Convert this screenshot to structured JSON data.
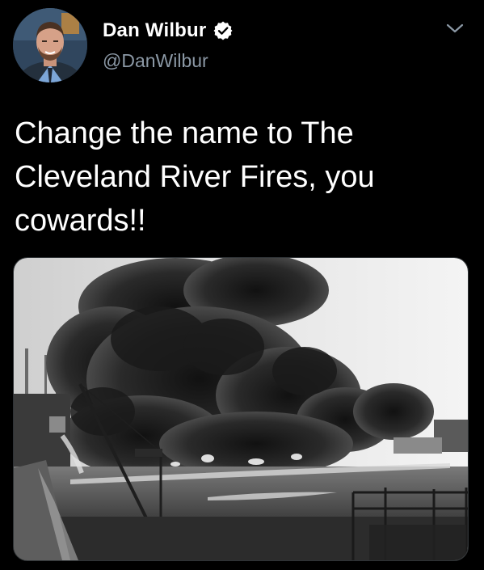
{
  "tweet": {
    "display_name": "Dan Wilbur",
    "handle": "@DanWilbur",
    "verified": true,
    "text": "Change the name to The\nCleveland River Fires, you\ncowards!!"
  },
  "icons": {
    "verified": "verified-badge-icon",
    "menu": "chevron-down-icon"
  },
  "colors": {
    "background": "#000000",
    "text": "#ffffff",
    "secondary_text": "#8b98a5",
    "verified_badge": "#ffffff"
  }
}
